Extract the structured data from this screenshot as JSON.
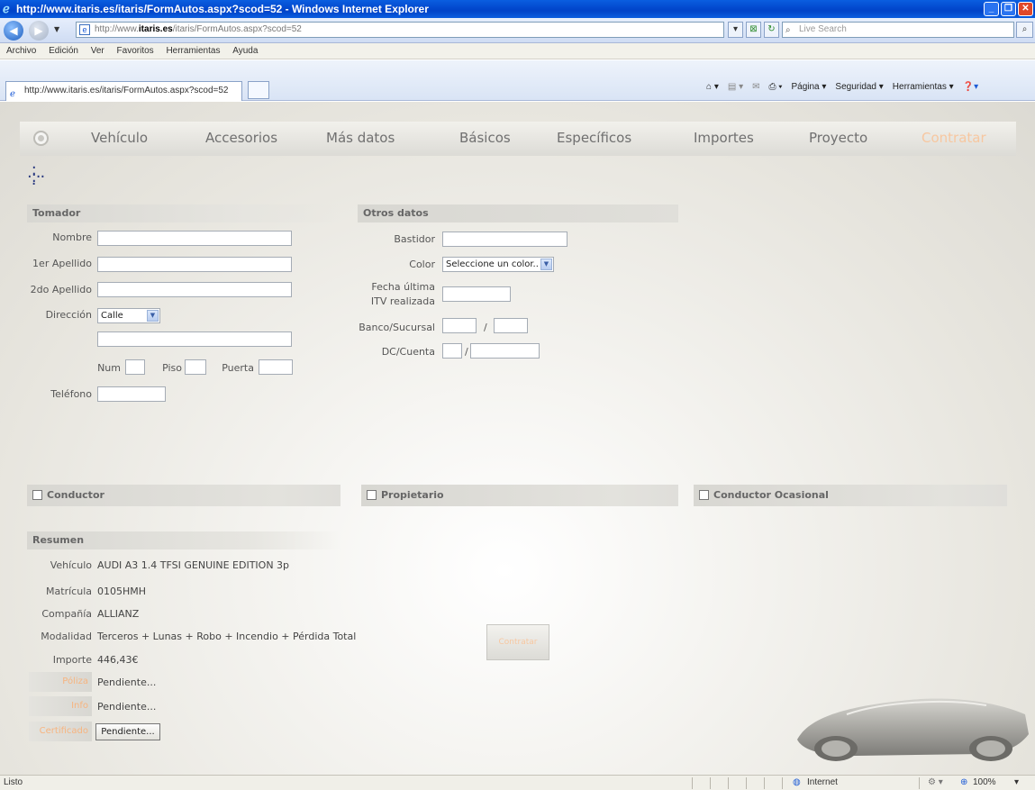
{
  "window": {
    "title": "http://www.itaris.es/itaris/FormAutos.aspx?scod=52 - Windows Internet Explorer",
    "buttons": [
      "_",
      "❐",
      "✕"
    ]
  },
  "addressbar": {
    "url_prefix": "http://www.",
    "url_domain": "itaris.es",
    "url_suffix": "/itaris/FormAutos.aspx?scod=52",
    "search_placeholder": "Live Search"
  },
  "menu": [
    "Archivo",
    "Edición",
    "Ver",
    "Favoritos",
    "Herramientas",
    "Ayuda"
  ],
  "tab": {
    "label": "http://www.itaris.es/itaris/FormAutos.aspx?scod=52"
  },
  "commandbar": [
    "Página ▾",
    "Seguridad ▾",
    "Herramientas ▾"
  ],
  "nav": {
    "items": [
      "Vehículo",
      "Accesorios",
      "Más datos",
      "Básicos",
      "Específicos",
      "Importes",
      "Proyecto",
      "Contratar"
    ]
  },
  "tomador": {
    "title": "Tomador",
    "nombre_label": "Nombre",
    "apellido1_label": "1er Apellido",
    "apellido2_label": "2do Apellido",
    "direccion_label": "Dirección",
    "direccion_tipo": "Calle",
    "num_label": "Num",
    "piso_label": "Piso",
    "puerta_label": "Puerta",
    "telefono_label": "Teléfono"
  },
  "otros": {
    "title": "Otros datos",
    "bastidor_label": "Bastidor",
    "color_label": "Color",
    "color_value": "Seleccione un color..",
    "itv_label_1": "Fecha última",
    "itv_label_2": "ITV realizada",
    "banco_label": "Banco/Sucursal",
    "dc_label": "DC/Cuenta",
    "slash": "/"
  },
  "checks": {
    "conductor": "Conductor",
    "propietario": "Propietario",
    "ocasional": "Conductor Ocasional"
  },
  "resumen": {
    "title": "Resumen",
    "vehiculo_label": "Vehículo",
    "vehiculo_value": "AUDI A3 1.4 TFSI GENUINE EDITION 3p",
    "matricula_label": "Matrícula",
    "matricula_value": "0105HMH",
    "compania_label": "Compañía",
    "compania_value": "ALLIANZ",
    "modalidad_label": "Modalidad",
    "modalidad_value": "Terceros + Lunas + Robo + Incendio + Pérdida Total",
    "importe_label": "Importe",
    "importe_value": "446,43€",
    "poliza_label": "Póliza",
    "poliza_value": "Pendiente...",
    "info_label": "Info",
    "info_value": "Pendiente...",
    "certificado_label": "Certificado",
    "certificado_value": "Pendiente..."
  },
  "contratar_button": "Contratar",
  "status": {
    "left": "Listo",
    "zone": "Internet",
    "zoom": "100%"
  }
}
